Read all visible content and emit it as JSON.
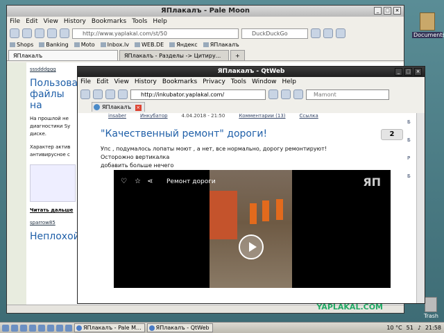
{
  "desktop": {
    "icon_label": "Documents",
    "trash_label": "Trash"
  },
  "palemoon": {
    "title": "ЯПлакалъ - Pale Moon",
    "menu": [
      "File",
      "Edit",
      "View",
      "History",
      "Bookmarks",
      "Tools",
      "Help"
    ],
    "url": "http://www.yaplakal.com/st/50",
    "search_placeholder": "DuckDuckGo",
    "bookmarks": [
      "Shops",
      "Banking",
      "Moto",
      "Inbox.lv",
      "WEB.DE",
      "Яндекс",
      "ЯПлакалъ"
    ],
    "tabs": [
      "ЯПлакалъ",
      "ЯПлакалъ - Разделы -> Цитиру..."
    ],
    "new_tab": "+",
    "content": {
      "user": "sssdddggg",
      "heading": "Пользоват файлы на",
      "para1": "На прошлой не диагностики Sy диске.",
      "para2": "Характер актив антивирусное с",
      "read_more": "Читать дальше",
      "user2": "sparrow85",
      "heading2": "Неплохой"
    },
    "status_logo": "YAPLAKAL.COM"
  },
  "qtweb": {
    "title": "ЯПлакалъ - QtWeb",
    "menu": [
      "File",
      "Edit",
      "View",
      "History",
      "Bookmarks",
      "Privacy",
      "Tools",
      "Window",
      "Help"
    ],
    "url": "http://inkubator.yaplakal.com/",
    "search_placeholder": "Mamont",
    "tab_label": "ЯПлакалъ",
    "meta": {
      "author": "insaber",
      "section": "Инкубатор",
      "date": "4.04.2018 - 21:50",
      "comments": "Комментарии (13)",
      "link": "Ссылка"
    },
    "post_title": "\"Качественный ремонт\" дороги!",
    "post_count": "2",
    "post_lines": [
      "Упс , подумалось лопаты моют , а нет, все нормально, дорогу ремонтируют!",
      "Осторожно вертикалка",
      "добавить больше нечего"
    ],
    "video_title": "Ремонт дороги",
    "video_logo": "ЯП",
    "right_links": [
      "Б",
      "Б",
      "Р",
      "Б"
    ]
  },
  "taskbar": {
    "apps": [
      "ЯПлакалъ - Pale M...",
      "ЯПлакалъ - QtWeb"
    ],
    "temp": "10 °C",
    "battery": "51",
    "time": "21:58"
  }
}
